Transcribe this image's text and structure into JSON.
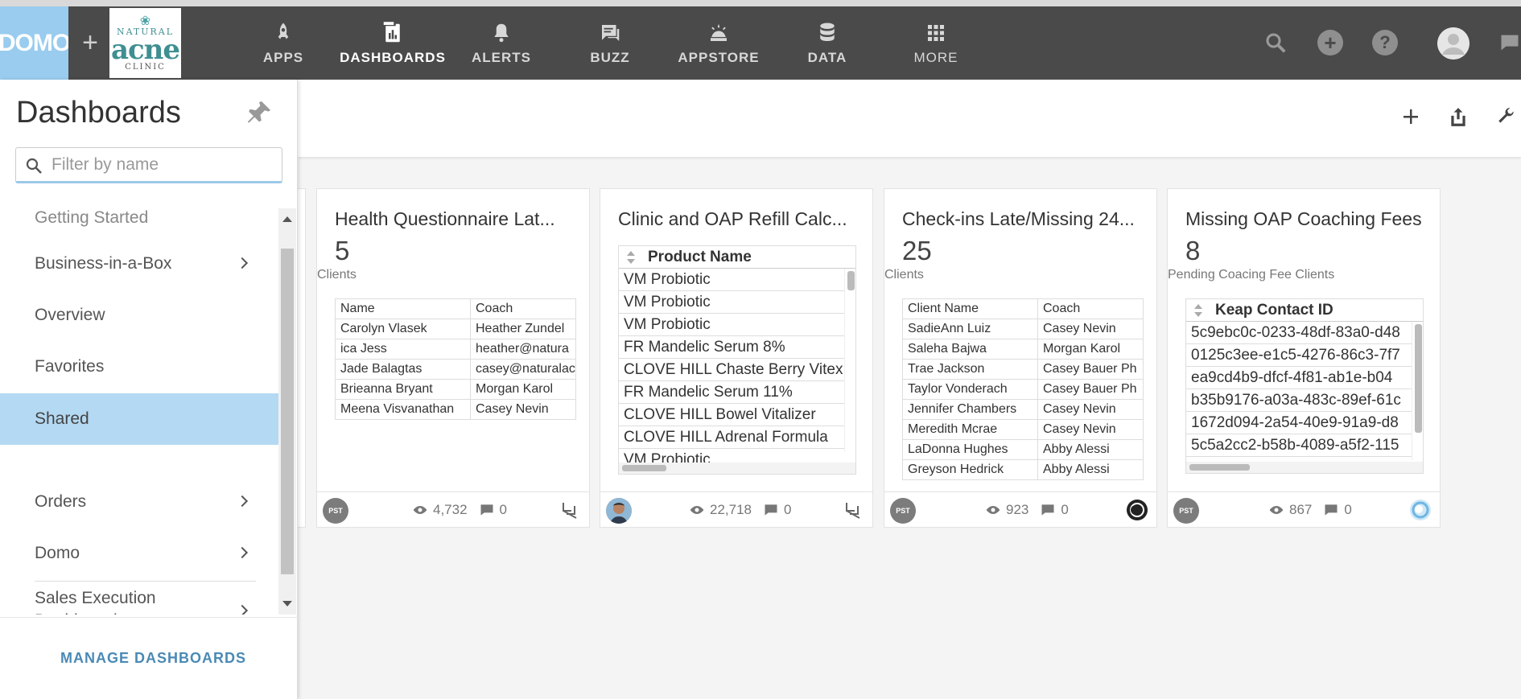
{
  "nav": {
    "logo": "DOMO",
    "brand": {
      "line1": "NATURAL",
      "line2": "acne",
      "line3": "CLINIC"
    },
    "items": [
      {
        "label": "APPS"
      },
      {
        "label": "DASHBOARDS"
      },
      {
        "label": "ALERTS"
      },
      {
        "label": "BUZZ"
      },
      {
        "label": "APPSTORE"
      },
      {
        "label": "DATA"
      },
      {
        "label": "MORE"
      }
    ]
  },
  "sidebar": {
    "title": "Dashboards",
    "filter_placeholder": "Filter by name",
    "items": [
      {
        "label": "Getting Started"
      },
      {
        "label": "Business-in-a-Box"
      },
      {
        "label": "Overview"
      },
      {
        "label": "Favorites"
      },
      {
        "label": "Shared"
      },
      {
        "label": "Orders"
      },
      {
        "label": "Domo"
      },
      {
        "label": "Sales Execution Dashboards"
      }
    ],
    "manage_label": "MANAGE DASHBOARDS"
  },
  "cards": [
    {
      "title": "Health Questionnaire Lat...",
      "value": "5",
      "subtitle": "Clients",
      "rows": [
        [
          "Name",
          "Coach"
        ],
        [
          "Carolyn Vlasek",
          "Heather Zundel"
        ],
        [
          "ica Jess",
          "heather@natura"
        ],
        [
          "Jade Balagtas",
          "casey@naturalac"
        ],
        [
          "Brieanna Bryant",
          "Morgan Karol"
        ],
        [
          "Meena Visvanathan",
          "Casey Nevin"
        ]
      ],
      "owner": "PST",
      "views": "4,732",
      "comments": "0"
    },
    {
      "title": "Clinic and OAP Refill Calc...",
      "header": "Product Name",
      "rows": [
        "VM Probiotic",
        "VM Probiotic",
        "VM Probiotic",
        "FR Mandelic Serum 8%",
        "CLOVE HILL Chaste Berry Vitex",
        "FR Mandelic Serum 11%",
        "CLOVE HILL Bowel Vitalizer",
        "CLOVE HILL Adrenal Formula",
        "VM Probiotic"
      ],
      "views": "22,718",
      "comments": "0"
    },
    {
      "title": "Check-ins Late/Missing 24...",
      "value": "25",
      "subtitle": "Clients",
      "rows": [
        [
          "Client Name",
          "Coach"
        ],
        [
          "SadieAnn Luiz",
          "Casey Nevin"
        ],
        [
          "Saleha Bajwa",
          "Morgan Karol"
        ],
        [
          "Trae Jackson",
          "Casey Bauer Ph"
        ],
        [
          "Taylor Vonderach",
          "Casey Bauer Ph"
        ],
        [
          "Jennifer Chambers",
          "Casey Nevin"
        ],
        [
          "Meredith Mcrae",
          "Casey Nevin"
        ],
        [
          "LaDonna Hughes",
          "Abby Alessi"
        ],
        [
          "Greyson Hedrick",
          "Abby Alessi"
        ]
      ],
      "owner": "PST",
      "views": "923",
      "comments": "0"
    },
    {
      "title": "Missing OAP Coaching Fees",
      "value": "8",
      "subtitle": "Pending Coacing Fee Clients",
      "header": "Keap Contact ID",
      "rows": [
        "5c9ebc0c-0233-48df-83a0-d48",
        "0125c3ee-e1c5-4276-86c3-7f7",
        "ea9cd4b9-dfcf-4f81-ab1e-b04",
        "b35b9176-a03a-483c-89ef-61c",
        "1672d094-2a54-40e9-91a9-d8",
        "5c5a2cc2-b58b-4089-a5f2-115"
      ],
      "owner": "PST",
      "views": "867",
      "comments": "0"
    }
  ]
}
